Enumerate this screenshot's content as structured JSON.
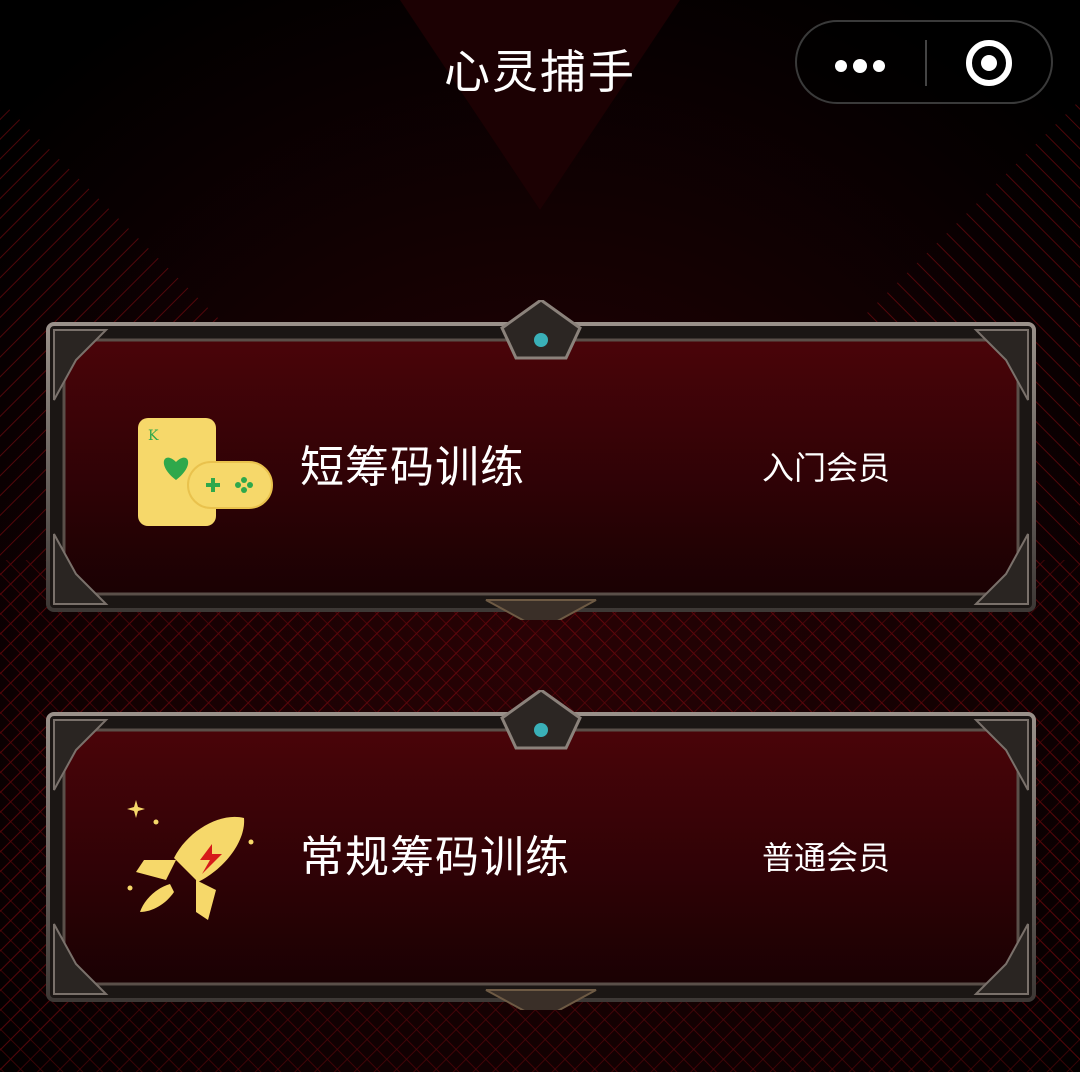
{
  "header": {
    "title": "心灵捕手"
  },
  "capsule": {
    "more_icon": "more-dots-icon",
    "close_icon": "target-close-icon"
  },
  "cards": [
    {
      "title": "短筹码训练",
      "level": "入门会员",
      "icon": "playing-card-gamepad-icon"
    },
    {
      "title": "常规筹码训练",
      "level": "普通会员",
      "icon": "rocket-icon"
    }
  ],
  "colors": {
    "background": "#000000",
    "card_fill": "#3a0306",
    "card_border": "#6e6560",
    "accent_red": "#c4101a",
    "icon_yellow": "#f6d86a",
    "icon_green": "#2fa84b",
    "text": "#ffffff"
  }
}
